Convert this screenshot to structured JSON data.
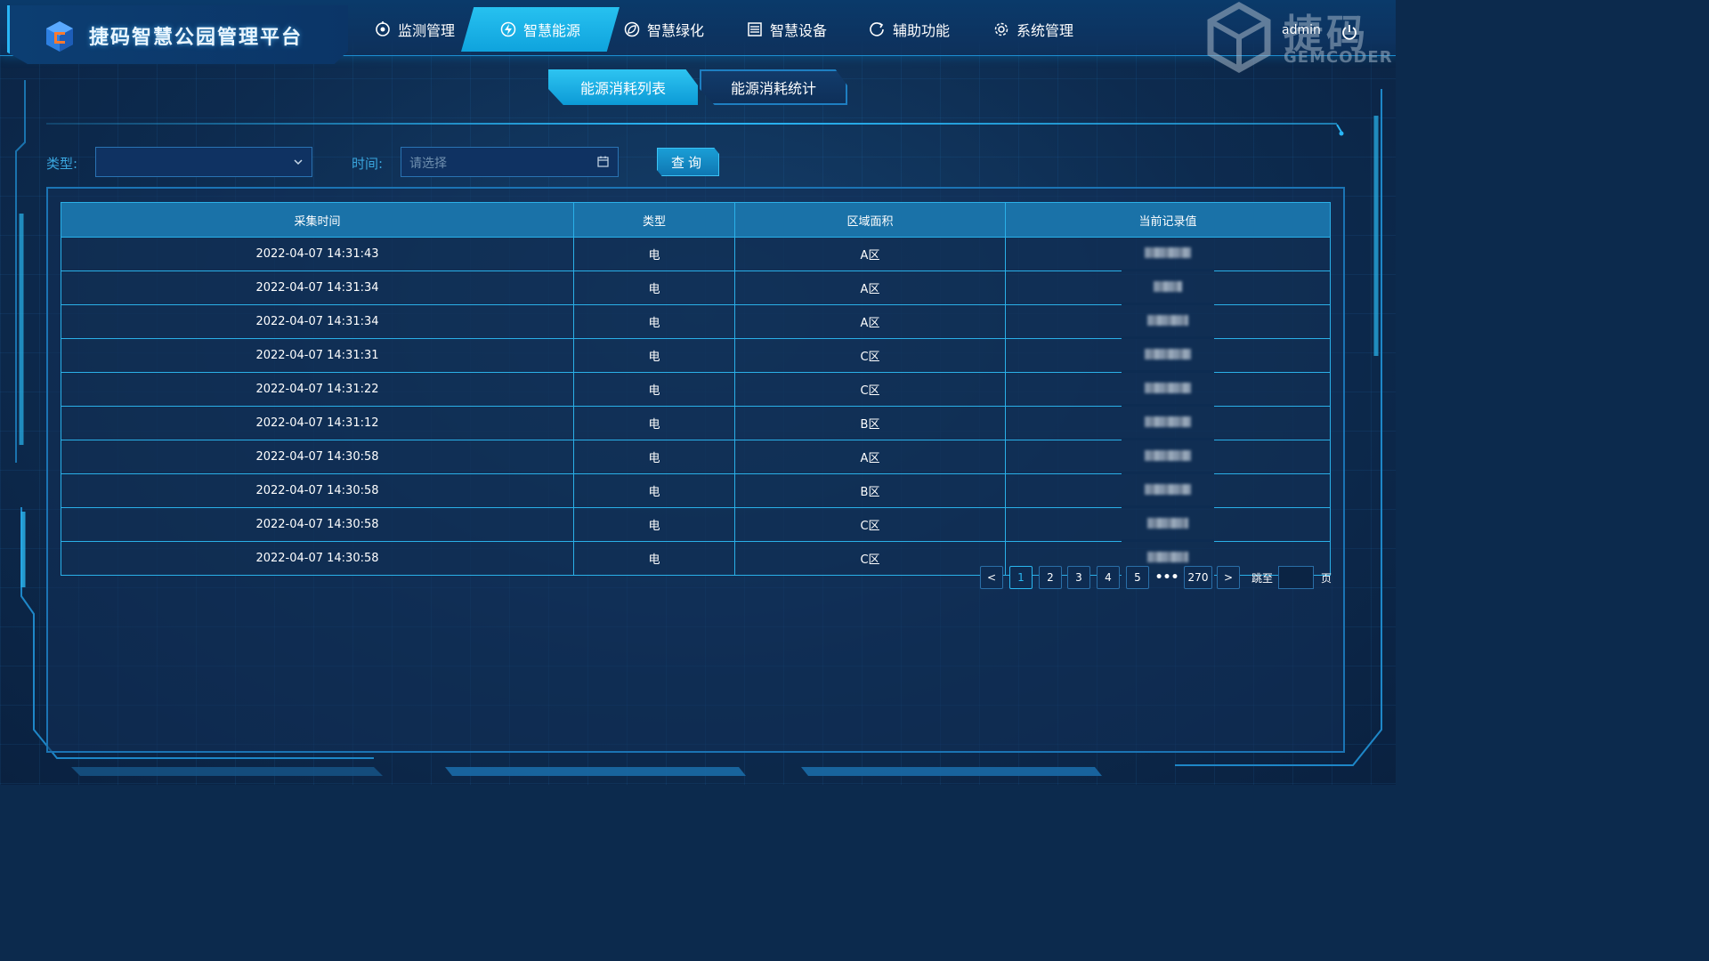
{
  "header": {
    "app_title": "捷码智慧公园管理平台",
    "user": "admin"
  },
  "nav": {
    "items": [
      {
        "label": "监测管理",
        "icon": "monitor-icon"
      },
      {
        "label": "智慧能源",
        "icon": "energy-icon",
        "active": true
      },
      {
        "label": "智慧绿化",
        "icon": "leaf-icon"
      },
      {
        "label": "智慧设备",
        "icon": "device-icon"
      },
      {
        "label": "辅助功能",
        "icon": "assist-icon"
      },
      {
        "label": "系统管理",
        "icon": "gear-icon"
      }
    ]
  },
  "watermark": {
    "text": "捷码",
    "sub": "GEMCODER"
  },
  "subtabs": {
    "list": "能源消耗列表",
    "stats": "能源消耗统计"
  },
  "filters": {
    "type_label": "类型:",
    "type_value": "",
    "time_label": "时间:",
    "time_placeholder": "请选择",
    "query_button": "查询"
  },
  "table": {
    "columns": [
      "采集时间",
      "类型",
      "区域面积",
      "当前记录值"
    ],
    "rows": [
      {
        "time": "2022-04-07 14:31:43",
        "type": "电",
        "area": "A区",
        "value": ""
      },
      {
        "time": "2022-04-07 14:31:34",
        "type": "电",
        "area": "A区",
        "value": ""
      },
      {
        "time": "2022-04-07 14:31:34",
        "type": "电",
        "area": "A区",
        "value": ""
      },
      {
        "time": "2022-04-07 14:31:31",
        "type": "电",
        "area": "C区",
        "value": ""
      },
      {
        "time": "2022-04-07 14:31:22",
        "type": "电",
        "area": "C区",
        "value": ""
      },
      {
        "time": "2022-04-07 14:31:12",
        "type": "电",
        "area": "B区",
        "value": ""
      },
      {
        "time": "2022-04-07 14:30:58",
        "type": "电",
        "area": "A区",
        "value": ""
      },
      {
        "time": "2022-04-07 14:30:58",
        "type": "电",
        "area": "B区",
        "value": ""
      },
      {
        "time": "2022-04-07 14:30:58",
        "type": "电",
        "area": "C区",
        "value": ""
      },
      {
        "time": "2022-04-07 14:30:58",
        "type": "电",
        "area": "C区",
        "value": ""
      }
    ]
  },
  "pagination": {
    "prev": "<",
    "next": ">",
    "pages": [
      "1",
      "2",
      "3",
      "4",
      "5"
    ],
    "current": "1",
    "ellipsis": "•••",
    "last": "270",
    "jump_label": "跳至",
    "page_suffix": "页"
  },
  "colors": {
    "accent": "#29b6f6",
    "background": "#0c2a4d",
    "table_header": "#1a72a8",
    "label": "#3aa6de"
  }
}
